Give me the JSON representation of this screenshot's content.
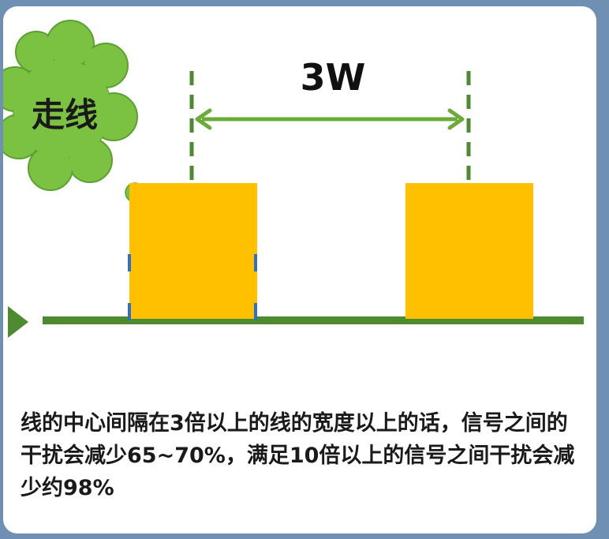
{
  "diagram": {
    "cloud_label": "走线",
    "spacing_label": "3W",
    "colors": {
      "trace": "#ffc000",
      "ground": "#4e8a2f",
      "dimension": "#6aab3a",
      "cloud": "#7cc242",
      "edge_marks": "#2f6fc4"
    }
  },
  "caption": {
    "text": "线的中心间隔在3倍以上的线的宽度以上的话，信号之间的干扰会减少65~70%，满足10倍以上的信号之间干扰会减少约98%"
  }
}
